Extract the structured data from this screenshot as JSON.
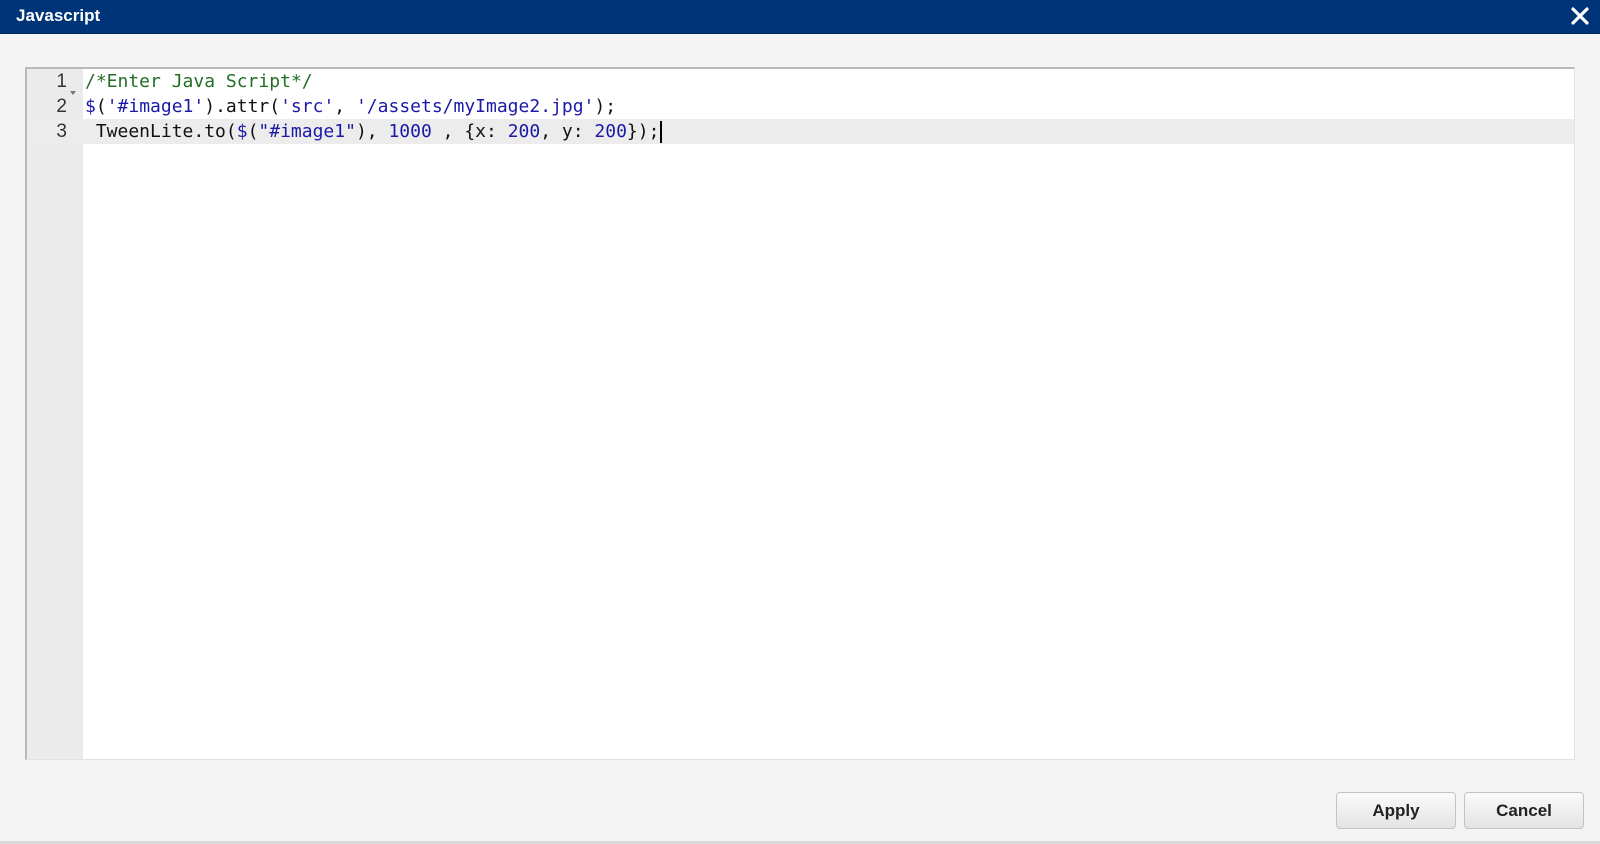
{
  "window": {
    "title": "Javascript",
    "close_icon": "close-icon"
  },
  "editor": {
    "lines": [
      {
        "number": "1",
        "foldable": true,
        "tokens": [
          {
            "text": "/*Enter Java Script*/",
            "type": "comment"
          }
        ]
      },
      {
        "number": "2",
        "foldable": false,
        "tokens": [
          {
            "text": "$",
            "type": "dollar"
          },
          {
            "text": "(",
            "type": "plain"
          },
          {
            "text": "'#image1'",
            "type": "str"
          },
          {
            "text": ").attr(",
            "type": "plain"
          },
          {
            "text": "'src'",
            "type": "str"
          },
          {
            "text": ", ",
            "type": "plain"
          },
          {
            "text": "'/assets/myImage2.jpg'",
            "type": "str"
          },
          {
            "text": ");",
            "type": "plain"
          }
        ]
      },
      {
        "number": "3",
        "foldable": false,
        "active": true,
        "tokens": [
          {
            "text": " TweenLite.to(",
            "type": "plain"
          },
          {
            "text": "$",
            "type": "dollar"
          },
          {
            "text": "(",
            "type": "plain"
          },
          {
            "text": "\"#image1\"",
            "type": "str"
          },
          {
            "text": "), ",
            "type": "plain"
          },
          {
            "text": "1000",
            "type": "num"
          },
          {
            "text": " , {x: ",
            "type": "plain"
          },
          {
            "text": "200",
            "type": "num"
          },
          {
            "text": ", y: ",
            "type": "plain"
          },
          {
            "text": "200",
            "type": "num"
          },
          {
            "text": "});",
            "type": "plain"
          }
        ]
      }
    ]
  },
  "actions": {
    "apply_label": "Apply",
    "cancel_label": "Cancel"
  },
  "colors": {
    "titlebar": "#003479",
    "comment": "#236e25",
    "string": "#1a1aa6"
  }
}
